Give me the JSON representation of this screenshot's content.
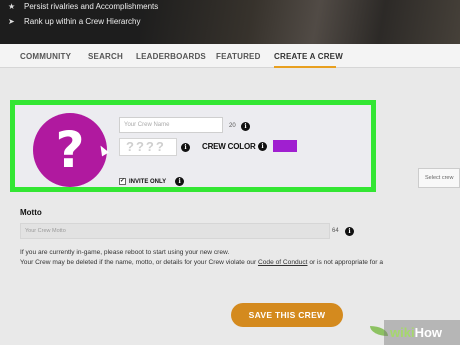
{
  "banner": {
    "lines": [
      "Persist rivalries and Accomplishments",
      "Rank up within a Crew Hierarchy"
    ]
  },
  "nav": {
    "items": [
      "COMMUNITY",
      "SEARCH",
      "LEADERBOARDS",
      "FEATURED",
      "CREATE A CREW"
    ],
    "active": "CREATE A CREW"
  },
  "crew_form": {
    "avatar_symbol": "?",
    "name_placeholder": "Your Crew Name",
    "name_counter": "20",
    "tag_placeholder": "????",
    "crew_color_label": "CREW COLOR",
    "crew_color": "#a01fd0",
    "invite_only_label": "INVITE ONLY",
    "invite_only_checked": true
  },
  "side": {
    "select_crew_label": "Select crew"
  },
  "motto": {
    "label": "Motto",
    "placeholder": "Your Crew Motto",
    "counter": "64"
  },
  "notes": {
    "line1": "If you are currently in-game, please reboot to start using your new crew.",
    "line2_prefix": "Your Crew may be deleted if the name, motto, or details for your Crew violate our ",
    "line2_link": "Code of Conduct",
    "line2_suffix": " or is not appropriate for a"
  },
  "save_button_label": "SAVE THIS CREW",
  "watermark": {
    "part1": "wiki",
    "part2": "How"
  },
  "colors": {
    "highlight": "#33e633",
    "avatar_bg": "#b0199f",
    "accent": "#d48a1e"
  }
}
